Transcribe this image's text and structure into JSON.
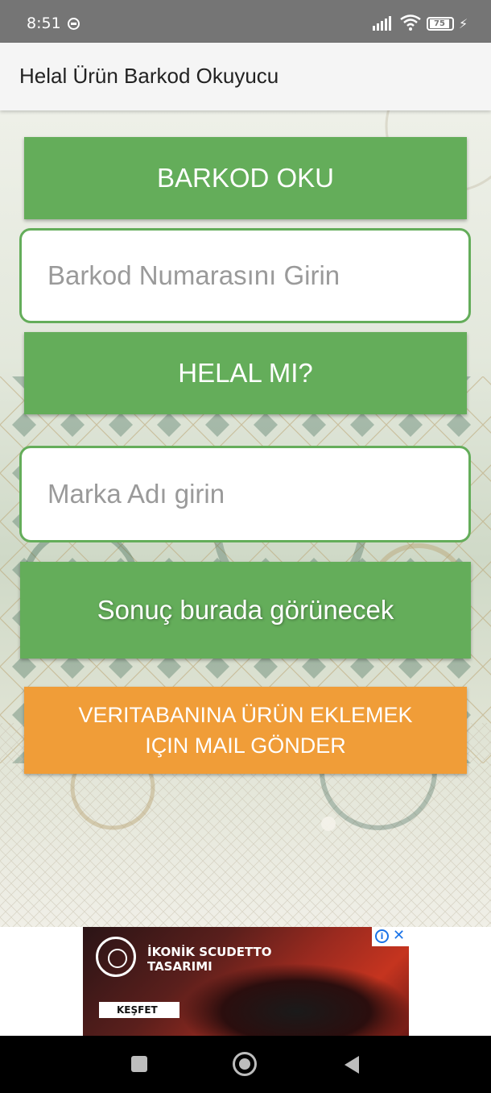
{
  "status_bar": {
    "time": "8:51",
    "battery": "75",
    "icons": [
      "dnd-icon",
      "signal-icon",
      "wifi-icon",
      "battery-icon",
      "charging-icon"
    ]
  },
  "app_bar": {
    "title": "Helal Ürün Barkod Okuyucu"
  },
  "main": {
    "scan_button": "BARKOD OKU",
    "barcode_input": {
      "placeholder": "Barkod Numarasını Girin",
      "value": ""
    },
    "check_button": "HELAL MI?",
    "brand_input": {
      "placeholder": "Marka Adı girin",
      "value": ""
    },
    "result_text": "Sonuç burada görünecek",
    "mail_button": {
      "line1": "VERITABANINA ÜRÜN EKLEMEK",
      "line2": "IÇIN MAIL GÖNDER"
    }
  },
  "ad": {
    "headline_line1": "İKONİK SCUDETTO",
    "headline_line2": "TASARIMI",
    "cta": "KEŞFET",
    "info_glyph": "i",
    "close_glyph": "✕"
  },
  "nav_bar": {
    "icons": [
      "recents-icon",
      "home-icon",
      "back-icon"
    ]
  },
  "colors": {
    "primary_green": "#64ad5a",
    "accent_orange": "#f09d38",
    "status_bar": "#757575",
    "app_bar": "#f5f5f5"
  }
}
